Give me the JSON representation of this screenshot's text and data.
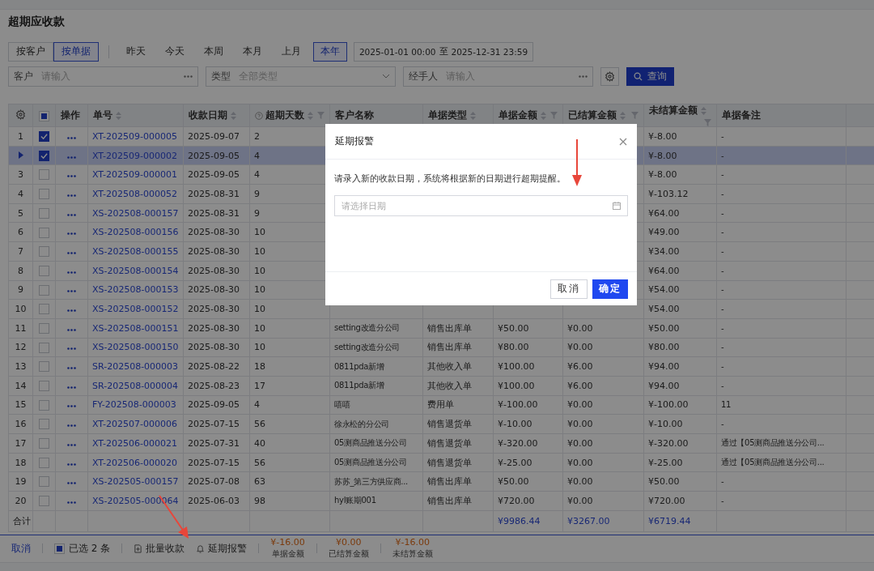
{
  "page_title": "超期应收款",
  "view_toggle": [
    {
      "label": "按客户",
      "selected": false
    },
    {
      "label": "按单据",
      "selected": true
    }
  ],
  "periods": [
    {
      "label": "昨天",
      "selected": false
    },
    {
      "label": "今天",
      "selected": false
    },
    {
      "label": "本周",
      "selected": false
    },
    {
      "label": "本月",
      "selected": false
    },
    {
      "label": "上月",
      "selected": false
    },
    {
      "label": "本年",
      "selected": true
    }
  ],
  "date_range": {
    "start": "2025-01-01 00:00",
    "separator": "至",
    "end": "2025-12-31 23:59"
  },
  "filters": [
    {
      "label": "客户",
      "placeholder": "请输入",
      "kind": "lookup"
    },
    {
      "label": "类型",
      "placeholder": "全部类型",
      "kind": "select"
    },
    {
      "label": "经手人",
      "placeholder": "请输入",
      "kind": "lookup"
    }
  ],
  "query_button": "查询",
  "table": {
    "columns": [
      {
        "kind": "settings"
      },
      {
        "kind": "check"
      },
      {
        "label": "操作",
        "kind": "text"
      },
      {
        "label": "单号",
        "kind": "text",
        "sortable": true
      },
      {
        "label": "收款日期",
        "kind": "text",
        "sortable": true
      },
      {
        "label": "超期天数",
        "kind": "text",
        "sortable": true,
        "filter": true,
        "help": true
      },
      {
        "label": "客户名称",
        "kind": "text"
      },
      {
        "label": "单据类型",
        "kind": "text",
        "sortable": true
      },
      {
        "label": "单据金额",
        "kind": "text",
        "sortable": true,
        "filter": true
      },
      {
        "label": "已结算金额",
        "kind": "text",
        "sortable": true,
        "filter": true
      },
      {
        "label": "未结算金额",
        "kind": "text",
        "sortable": true,
        "filter": true
      },
      {
        "label": "单据备注",
        "kind": "text"
      },
      {
        "kind": "blank"
      }
    ],
    "header_indeterminate": true,
    "rows": [
      {
        "index": "1",
        "selected": false,
        "checked": true,
        "number": "XT-202509-000005",
        "date": "2025-09-07",
        "days": "2",
        "unsettled": "¥-8.00",
        "remark": "-"
      },
      {
        "selected": true,
        "checked": true,
        "number": "XT-202509-000002",
        "date": "2025-09-05",
        "days": "4",
        "unsettled": "¥-8.00",
        "remark": "-"
      },
      {
        "index": "3",
        "selected": false,
        "checked": false,
        "number": "XT-202509-000001",
        "date": "2025-09-05",
        "days": "4",
        "unsettled": "¥-8.00",
        "remark": "-"
      },
      {
        "index": "4",
        "selected": false,
        "checked": false,
        "number": "XT-202508-000052",
        "date": "2025-08-31",
        "days": "9",
        "unsettled": "¥-103.12",
        "remark": "-"
      },
      {
        "index": "5",
        "selected": false,
        "checked": false,
        "number": "XS-202508-000157",
        "date": "2025-08-31",
        "days": "9",
        "unsettled": "¥64.00",
        "remark": "-"
      },
      {
        "index": "6",
        "selected": false,
        "checked": false,
        "number": "XS-202508-000156",
        "date": "2025-08-30",
        "days": "10",
        "unsettled": "¥49.00",
        "remark": "-"
      },
      {
        "index": "7",
        "selected": false,
        "checked": false,
        "number": "XS-202508-000155",
        "date": "2025-08-30",
        "days": "10",
        "unsettled": "¥34.00",
        "remark": "-"
      },
      {
        "index": "8",
        "selected": false,
        "checked": false,
        "number": "XS-202508-000154",
        "date": "2025-08-30",
        "days": "10",
        "unsettled": "¥64.00",
        "remark": "-"
      },
      {
        "index": "9",
        "selected": false,
        "checked": false,
        "number": "XS-202508-000153",
        "date": "2025-08-30",
        "days": "10",
        "unsettled": "¥54.00",
        "remark": "-"
      },
      {
        "index": "10",
        "selected": false,
        "checked": false,
        "number": "XS-202508-000152",
        "date": "2025-08-30",
        "days": "10",
        "unsettled": "¥54.00",
        "remark": "-"
      },
      {
        "index": "11",
        "selected": false,
        "checked": false,
        "number": "XS-202508-000151",
        "date": "2025-08-30",
        "days": "10",
        "customer": "setting改造分公司",
        "type": "销售出库单",
        "amount": "¥50.00",
        "settled": "¥0.00",
        "unsettled": "¥50.00",
        "remark": "-"
      },
      {
        "index": "12",
        "selected": false,
        "checked": false,
        "number": "XS-202508-000150",
        "date": "2025-08-30",
        "days": "10",
        "customer": "setting改造分公司",
        "type": "销售出库单",
        "amount": "¥80.00",
        "settled": "¥0.00",
        "unsettled": "¥80.00",
        "remark": "-"
      },
      {
        "index": "13",
        "selected": false,
        "checked": false,
        "number": "SR-202508-000003",
        "date": "2025-08-22",
        "days": "18",
        "customer": "0811pda新增",
        "type": "其他收入单",
        "amount": "¥100.00",
        "settled": "¥6.00",
        "unsettled": "¥94.00",
        "remark": "-"
      },
      {
        "index": "14",
        "selected": false,
        "checked": false,
        "number": "SR-202508-000004",
        "date": "2025-08-23",
        "days": "17",
        "customer": "0811pda新增",
        "type": "其他收入单",
        "amount": "¥100.00",
        "settled": "¥6.00",
        "unsettled": "¥94.00",
        "remark": "-"
      },
      {
        "index": "15",
        "selected": false,
        "checked": false,
        "number": "FY-202508-000003",
        "date": "2025-09-05",
        "days": "4",
        "customer": "嘻嘻",
        "type": "费用单",
        "amount": "¥-100.00",
        "settled": "¥0.00",
        "unsettled": "¥-100.00",
        "remark": "11"
      },
      {
        "index": "16",
        "selected": false,
        "checked": false,
        "number": "XT-202507-000006",
        "date": "2025-07-15",
        "days": "56",
        "customer": "徐永松的分公司",
        "type": "销售退货单",
        "amount": "¥-10.00",
        "settled": "¥0.00",
        "unsettled": "¥-10.00",
        "remark": "-"
      },
      {
        "index": "17",
        "selected": false,
        "checked": false,
        "number": "XT-202506-000021",
        "date": "2025-07-31",
        "days": "40",
        "customer": "05测商品推送分公司",
        "type": "销售退货单",
        "amount": "¥-320.00",
        "settled": "¥0.00",
        "unsettled": "¥-320.00",
        "remark": "通过【05测商品推送分公司..."
      },
      {
        "index": "18",
        "selected": false,
        "checked": false,
        "number": "XT-202506-000020",
        "date": "2025-07-15",
        "days": "56",
        "customer": "05测商品推送分公司",
        "type": "销售退货单",
        "amount": "¥-25.00",
        "settled": "¥0.00",
        "unsettled": "¥-25.00",
        "remark": "通过【05测商品推送分公司..."
      },
      {
        "index": "19",
        "selected": false,
        "checked": false,
        "number": "XS-202505-000157",
        "date": "2025-07-08",
        "days": "63",
        "customer": "苏苏_第三方供应商...",
        "type": "销售出库单",
        "amount": "¥50.00",
        "settled": "¥0.00",
        "unsettled": "¥50.00",
        "remark": "-"
      },
      {
        "index": "20",
        "selected": false,
        "checked": false,
        "number": "XS-202505-000064",
        "date": "2025-06-03",
        "days": "98",
        "customer": "hyl账期001",
        "type": "销售出库单",
        "amount": "¥720.00",
        "settled": "¥0.00",
        "unsettled": "¥720.00",
        "remark": "-"
      }
    ],
    "totals": {
      "label": "合计",
      "amount": "¥9986.44",
      "settled": "¥3267.00",
      "unsettled": "¥6719.44"
    }
  },
  "footer": {
    "cancel": "取消",
    "selection_indeterminate": true,
    "selected_count": "已选 2 条",
    "actions": [
      {
        "label": "批量收款",
        "kind": "batch"
      },
      {
        "label": "延期报警",
        "kind": "alarm"
      }
    ],
    "summaries": [
      {
        "value": "¥-16.00",
        "label": "单据金额"
      },
      {
        "value": "¥0.00",
        "label": "已结算金额"
      },
      {
        "value": "¥-16.00",
        "label": "未结算金额"
      }
    ]
  },
  "dialog": {
    "title": "延期报警",
    "message": "请录入新的收款日期，系统将根据新的日期进行超期提醒。",
    "date_placeholder": "请选择日期",
    "buttons": [
      {
        "label": "取消",
        "kind": "secondary"
      },
      {
        "label": "确定",
        "kind": "primary"
      }
    ]
  }
}
